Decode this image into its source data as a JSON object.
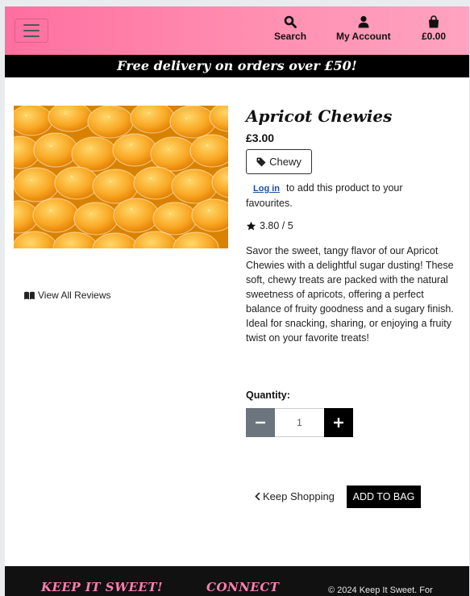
{
  "header": {
    "menu_toggle_icon": "hamburger-icon",
    "nav": [
      {
        "icon": "search-icon",
        "label": "Search"
      },
      {
        "icon": "user-icon",
        "label": "My Account"
      },
      {
        "icon": "shopping-bag-icon",
        "label": "£0.00"
      }
    ],
    "brand_colors": {
      "gradient_start": "#ff6fa0",
      "gradient_end": "#ffa3c0"
    }
  },
  "banner": {
    "text": "Free delivery on orders over £50!"
  },
  "product": {
    "name": "Apricot Chewies",
    "price": "£3.00",
    "category": "Chewy",
    "favourites": {
      "login_link": "Log in",
      "message": "to add this product to your favourites."
    },
    "rating": "3.80 / 5",
    "description": "Savor the sweet, tangy flavor of our Apricot Chewies with a delightful sugar dusting! These soft, chewy treats are packed with the natural sweetness of apricots, offering a perfect balance of fruity goodness and a sugary finish. Ideal for snacking, sharing, or enjoying a fruity twist on your favorite treats!",
    "reviews_link": "View All Reviews",
    "quantity_label": "Quantity:",
    "quantity_value": "1"
  },
  "actions": {
    "keep_shopping": "Keep Shopping",
    "add_to_bag": "ADD TO BAG"
  },
  "footer": {
    "brand": "KEEP IT SWEET!",
    "connect_heading": "CONNECT",
    "copyright": "© 2024 Keep It Sweet. For"
  }
}
